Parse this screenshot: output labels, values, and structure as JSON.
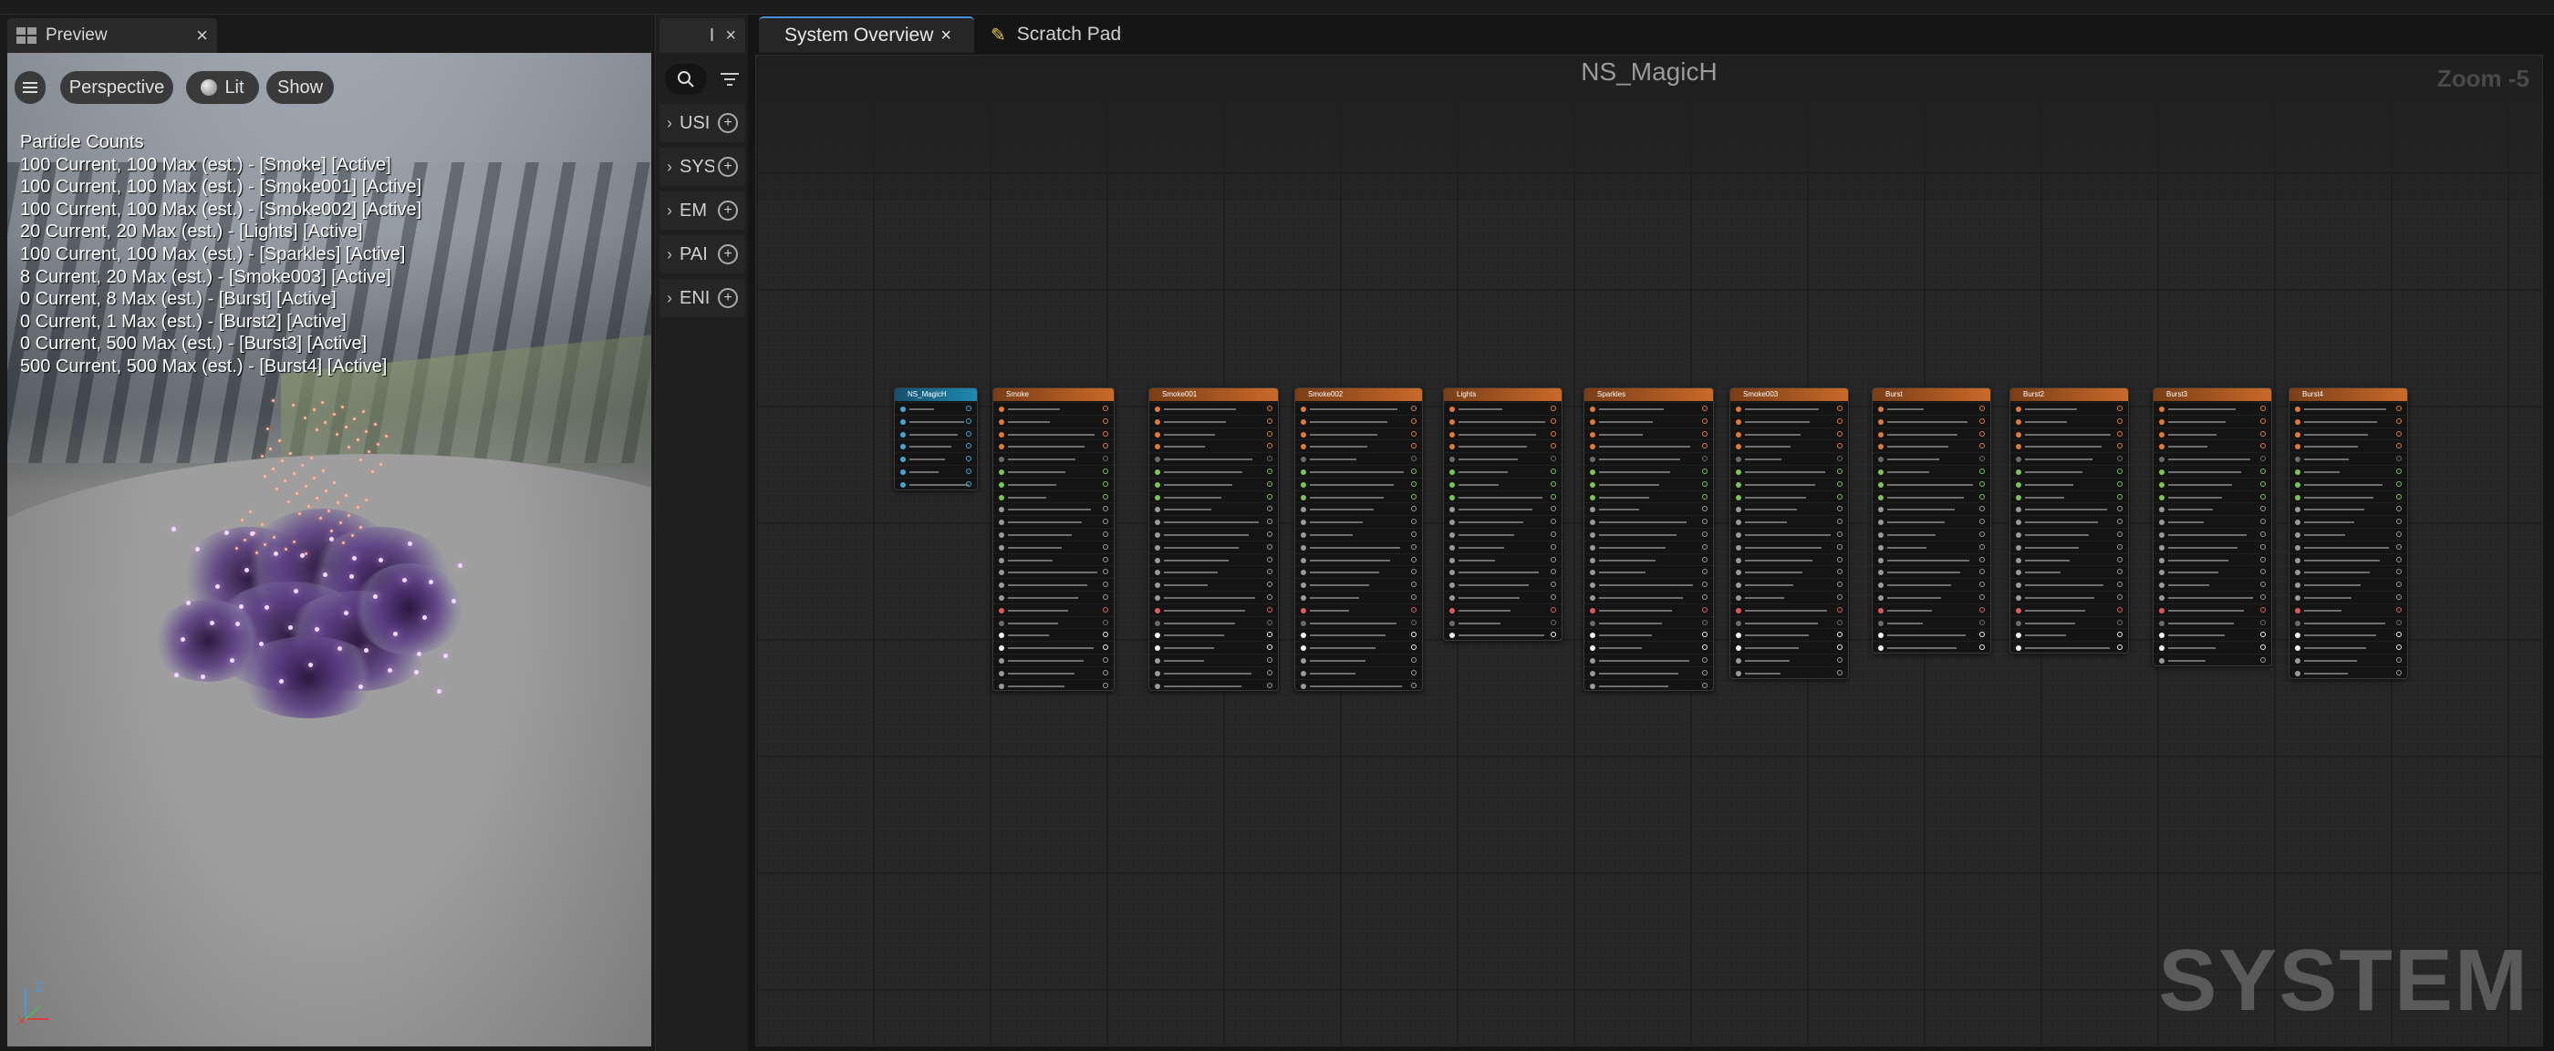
{
  "preview": {
    "tab_label": "Preview",
    "tab_close": "×",
    "buttons": {
      "perspective": "Perspective",
      "lit": "Lit",
      "show": "Show"
    },
    "particle_counts": [
      "Particle Counts",
      "100 Current, 100 Max (est.) - [Smoke] [Active]",
      "100 Current, 100 Max (est.) - [Smoke001] [Active]",
      "100 Current, 100 Max (est.) - [Smoke002] [Active]",
      "20 Current, 20 Max (est.) - [Lights] [Active]",
      "100 Current, 100 Max (est.) - [Sparkles] [Active]",
      "8 Current, 20 Max (est.) - [Smoke003] [Active]",
      "0 Current, 8 Max (est.) - [Burst] [Active]",
      "0 Current, 1 Max (est.) - [Burst2] [Active]",
      "0 Current, 500 Max (est.) - [Burst3] [Active]",
      "500 Current, 500 Max (est.) - [Burst4] [Active]"
    ],
    "axis_labels": {
      "z": "Z"
    }
  },
  "mid_panel": {
    "tab_label": "I",
    "tab_close": "×",
    "items": [
      {
        "label": "USI"
      },
      {
        "label": "SYS"
      },
      {
        "label": "EM"
      },
      {
        "label": "PAI"
      },
      {
        "label": "ENI"
      }
    ]
  },
  "tabs": [
    {
      "label": "System Overview",
      "close": "×"
    },
    {
      "label": "Scratch Pad"
    }
  ],
  "graph": {
    "title": "NS_MagicH",
    "zoom": "Zoom -5",
    "watermark": "SYSTEM",
    "nodes": [
      {
        "name": "NS_MagicH",
        "kind": "system",
        "rows": 7
      },
      {
        "name": "Smoke",
        "kind": "emitter",
        "rows": 23
      },
      {
        "name": "Smoke001",
        "kind": "emitter",
        "rows": 23
      },
      {
        "name": "Smoke002",
        "kind": "emitter",
        "rows": 23
      },
      {
        "name": "Lights",
        "kind": "emitter",
        "rows": 19
      },
      {
        "name": "Sparkles",
        "kind": "emitter",
        "rows": 23
      },
      {
        "name": "Smoke003",
        "kind": "emitter",
        "rows": 22
      },
      {
        "name": "Burst",
        "kind": "emitter",
        "rows": 20
      },
      {
        "name": "Burst2",
        "kind": "emitter",
        "rows": 20
      },
      {
        "name": "Burst3",
        "kind": "emitter",
        "rows": 21
      },
      {
        "name": "Burst4",
        "kind": "emitter",
        "rows": 22
      }
    ]
  },
  "colors": {
    "accent": "#4a90d9",
    "emitter_header": "#c96a2a",
    "system_header": "#1f8ab3"
  }
}
